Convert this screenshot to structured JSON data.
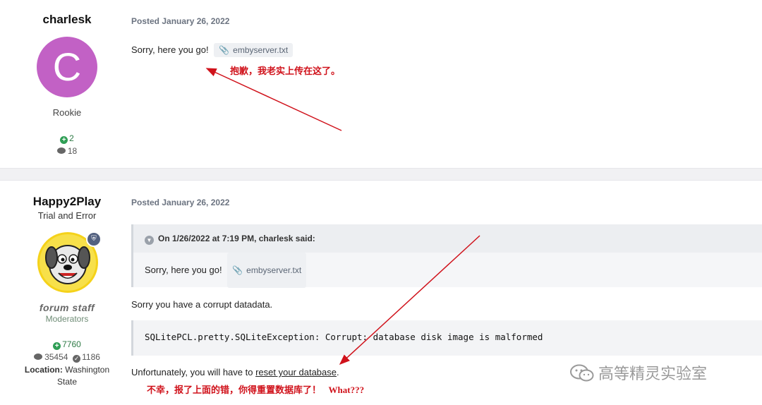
{
  "post1": {
    "username": "charlesk",
    "avatar_letter": "C",
    "rank": "Rookie",
    "reputation": "2",
    "posts": "18",
    "posted": "Posted January 26, 2022",
    "body": "Sorry, here you go!",
    "attachment": "embyserver.txt",
    "annotation": "抱歉，我老实上传在这了。"
  },
  "post2": {
    "username": "Happy2Play",
    "user_title": "Trial and Error",
    "group_image_text": "forum staff",
    "group": "Moderators",
    "reputation": "7760",
    "posts": "35454",
    "solutions": "1186",
    "location_label": "Location:",
    "location_value": "Washington",
    "location_value2": "State",
    "posted": "Posted January 26, 2022",
    "quote_header": "On 1/26/2022 at 7:19 PM, charlesk said:",
    "quote_body": "Sorry, here you go!",
    "quote_attachment": "embyserver.txt",
    "text1": "Sorry you have a corrupt datadata.",
    "code": "SQLitePCL.pretty.SQLiteException: Corrupt: database disk image is malformed",
    "text2_prefix": "Unfortunately, you will have to",
    "text2_link": "reset your database",
    "text2_suffix": ".",
    "annotation": "不幸，报了上面的错，你得重置数据库了！",
    "annotation_what": "What???"
  },
  "watermark": "高等精灵实验室",
  "colors": {
    "annotation_red": "#d0121b",
    "avatar_purple": "#c261c5",
    "reputation_green": "#2f9e55"
  }
}
